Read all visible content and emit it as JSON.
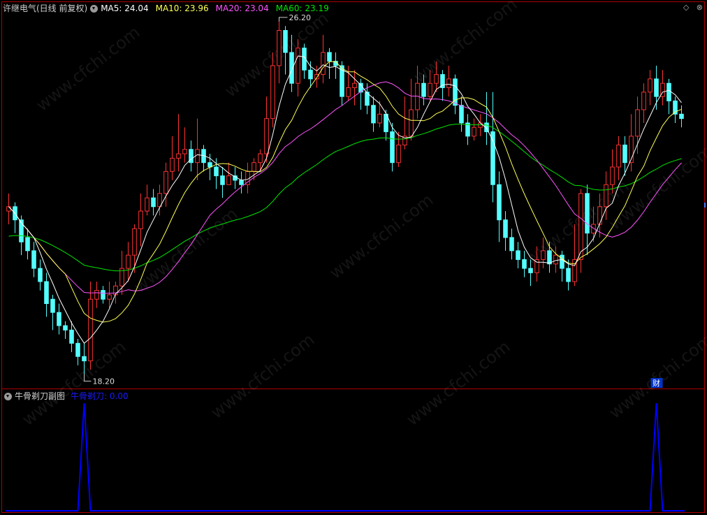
{
  "main_header": {
    "title": "许继电气(日线 前复权)",
    "ma5": "MA5: 24.04",
    "ma10": "MA10: 23.96",
    "ma20": "MA20: 23.04",
    "ma60": "MA60: 23.19"
  },
  "sub_header": {
    "title": "牛骨剃刀副图",
    "indicator": "牛骨剃刀: 0.00"
  },
  "annotations": {
    "high": "26.20",
    "low": "18.20",
    "fin_marker": "财"
  },
  "watermark": "www.cfchi.com",
  "colors": {
    "up": "#ff3232",
    "down": "#54ffff",
    "ma5": "#ffffff",
    "ma10": "#ffff54",
    "ma20": "#ff54ff",
    "ma60": "#00e600",
    "indicator": "#0000ff",
    "border": "#b00000"
  },
  "chart_data": [
    {
      "type": "candlestick",
      "title": "许继电气(日线 前复权)",
      "ylim": [
        18.0,
        26.5
      ],
      "price_high": 26.2,
      "price_low": 18.2,
      "series": [
        {
          "name": "MA5",
          "latest": 24.04
        },
        {
          "name": "MA10",
          "latest": 23.96
        },
        {
          "name": "MA20",
          "latest": 23.04
        },
        {
          "name": "MA60",
          "latest": 23.19
        }
      ],
      "candles": [
        [
          21.9,
          22.0,
          22.3,
          21.6
        ],
        [
          22.0,
          21.7,
          22.1,
          21.4
        ],
        [
          21.7,
          21.2,
          21.8,
          20.9
        ],
        [
          21.3,
          21.0,
          21.5,
          20.8
        ],
        [
          21.0,
          20.6,
          21.2,
          20.4
        ],
        [
          20.6,
          20.3,
          20.8,
          20.1
        ],
        [
          20.3,
          19.8,
          20.5,
          19.5
        ],
        [
          19.9,
          19.6,
          20.0,
          19.2
        ],
        [
          19.6,
          19.3,
          19.8,
          19.1
        ],
        [
          19.3,
          19.2,
          19.4,
          19.0
        ],
        [
          19.2,
          18.9,
          19.4,
          18.7
        ],
        [
          18.9,
          18.6,
          19.0,
          18.4
        ],
        [
          18.6,
          18.5,
          18.9,
          18.2
        ],
        [
          18.5,
          19.9,
          20.3,
          18.3
        ],
        [
          19.9,
          20.1,
          20.3,
          19.7
        ],
        [
          20.1,
          19.9,
          20.2,
          19.8
        ],
        [
          19.9,
          20.0,
          20.3,
          19.7
        ],
        [
          20.0,
          20.2,
          20.3,
          19.8
        ],
        [
          20.2,
          20.6,
          21.0,
          20.0
        ],
        [
          20.6,
          20.9,
          21.2,
          20.3
        ],
        [
          20.9,
          21.5,
          21.6,
          20.5
        ],
        [
          21.5,
          21.9,
          22.3,
          21.1
        ],
        [
          21.9,
          22.2,
          22.5,
          21.8
        ],
        [
          22.2,
          22.0,
          22.4,
          21.8
        ],
        [
          22.0,
          22.3,
          22.5,
          21.8
        ],
        [
          22.3,
          22.8,
          23.0,
          22.0
        ],
        [
          22.8,
          23.1,
          23.6,
          22.6
        ],
        [
          23.1,
          23.2,
          24.1,
          22.8
        ],
        [
          23.2,
          23.3,
          23.8,
          23.0
        ],
        [
          23.3,
          23.0,
          23.5,
          22.8
        ],
        [
          23.0,
          23.3,
          24.0,
          22.6
        ],
        [
          23.3,
          23.0,
          23.4,
          22.8
        ],
        [
          23.0,
          22.9,
          23.2,
          22.6
        ],
        [
          22.9,
          22.7,
          23.1,
          22.4
        ],
        [
          22.7,
          22.5,
          22.9,
          22.2
        ],
        [
          22.5,
          22.7,
          23.0,
          22.5
        ],
        [
          22.7,
          22.6,
          22.9,
          22.4
        ],
        [
          22.6,
          22.5,
          22.8,
          22.3
        ],
        [
          22.5,
          22.8,
          23.0,
          22.3
        ],
        [
          22.8,
          23.0,
          23.1,
          22.6
        ],
        [
          23.0,
          23.2,
          23.3,
          22.8
        ],
        [
          23.2,
          24.0,
          24.5,
          23.0
        ],
        [
          24.0,
          25.2,
          25.5,
          23.8
        ],
        [
          25.2,
          26.0,
          26.2,
          24.8
        ],
        [
          26.0,
          25.5,
          26.1,
          25.0
        ],
        [
          25.5,
          24.8,
          25.9,
          24.6
        ],
        [
          24.8,
          25.6,
          25.8,
          24.5
        ],
        [
          25.6,
          25.1,
          25.7,
          24.9
        ],
        [
          25.1,
          24.9,
          25.3,
          24.7
        ],
        [
          24.9,
          25.0,
          25.2,
          24.7
        ],
        [
          25.0,
          25.5,
          25.9,
          24.8
        ],
        [
          25.5,
          25.3,
          25.6,
          24.9
        ],
        [
          25.3,
          25.2,
          25.5,
          24.9
        ],
        [
          25.2,
          24.5,
          25.3,
          24.3
        ],
        [
          24.5,
          24.7,
          25.2,
          24.4
        ],
        [
          24.7,
          24.8,
          25.1,
          24.3
        ],
        [
          24.8,
          24.6,
          24.9,
          24.2
        ],
        [
          24.6,
          24.3,
          24.8,
          24.1
        ],
        [
          24.3,
          23.9,
          24.5,
          23.7
        ],
        [
          23.9,
          24.1,
          24.4,
          23.8
        ],
        [
          24.1,
          23.7,
          24.2,
          23.5
        ],
        [
          23.7,
          23.0,
          23.9,
          22.8
        ],
        [
          23.0,
          23.4,
          23.7,
          22.9
        ],
        [
          23.4,
          23.6,
          24.5,
          23.3
        ],
        [
          23.6,
          24.2,
          24.9,
          23.5
        ],
        [
          24.2,
          24.8,
          25.2,
          24.0
        ],
        [
          24.8,
          24.5,
          25.0,
          24.3
        ],
        [
          24.5,
          24.8,
          25.1,
          24.4
        ],
        [
          24.8,
          25.0,
          25.3,
          24.6
        ],
        [
          25.0,
          24.7,
          25.1,
          24.4
        ],
        [
          24.7,
          24.9,
          25.2,
          24.5
        ],
        [
          24.9,
          24.3,
          25.0,
          24.1
        ],
        [
          24.3,
          23.9,
          24.5,
          23.7
        ],
        [
          23.9,
          23.6,
          24.1,
          23.4
        ],
        [
          23.6,
          23.8,
          24.0,
          23.5
        ],
        [
          23.8,
          23.9,
          24.1,
          23.6
        ],
        [
          23.9,
          23.7,
          24.6,
          23.4
        ],
        [
          23.7,
          22.5,
          24.6,
          22.1
        ],
        [
          22.5,
          21.7,
          22.8,
          21.2
        ],
        [
          21.7,
          21.3,
          21.9,
          21.0
        ],
        [
          21.3,
          21.0,
          21.5,
          20.8
        ],
        [
          21.0,
          20.8,
          21.2,
          20.6
        ],
        [
          20.8,
          20.6,
          21.0,
          20.4
        ],
        [
          20.6,
          20.5,
          20.8,
          20.2
        ],
        [
          20.5,
          20.8,
          21.1,
          20.3
        ],
        [
          20.8,
          21.0,
          21.3,
          20.6
        ],
        [
          21.0,
          20.7,
          21.2,
          20.5
        ],
        [
          20.7,
          20.9,
          21.1,
          20.5
        ],
        [
          20.9,
          20.6,
          21.0,
          20.3
        ],
        [
          20.6,
          20.3,
          20.8,
          20.1
        ],
        [
          20.3,
          20.8,
          21.6,
          20.2
        ],
        [
          20.8,
          22.3,
          22.4,
          20.5
        ],
        [
          22.3,
          21.4,
          22.5,
          20.9
        ],
        [
          21.4,
          21.6,
          22.0,
          21.2
        ],
        [
          21.6,
          22.0,
          22.3,
          21.3
        ],
        [
          22.0,
          22.5,
          22.8,
          21.7
        ],
        [
          22.5,
          22.9,
          23.3,
          22.3
        ],
        [
          22.9,
          23.4,
          23.6,
          22.6
        ],
        [
          23.4,
          23.0,
          23.6,
          22.7
        ],
        [
          23.0,
          23.6,
          24.1,
          22.8
        ],
        [
          23.6,
          24.2,
          24.5,
          23.2
        ],
        [
          24.2,
          24.6,
          24.8,
          23.9
        ],
        [
          24.6,
          24.9,
          25.1,
          24.3
        ],
        [
          24.9,
          24.5,
          25.2,
          24.2
        ],
        [
          24.5,
          24.8,
          25.1,
          24.3
        ],
        [
          24.8,
          24.4,
          24.9,
          24.1
        ],
        [
          24.4,
          24.1,
          24.5,
          23.9
        ],
        [
          24.1,
          24.0,
          24.3,
          23.8
        ]
      ]
    },
    {
      "type": "line",
      "title": "牛骨剃刀",
      "series": [
        {
          "name": "牛骨剃刀",
          "latest": 0.0,
          "spike_bars": [
            12,
            103
          ]
        }
      ]
    }
  ]
}
